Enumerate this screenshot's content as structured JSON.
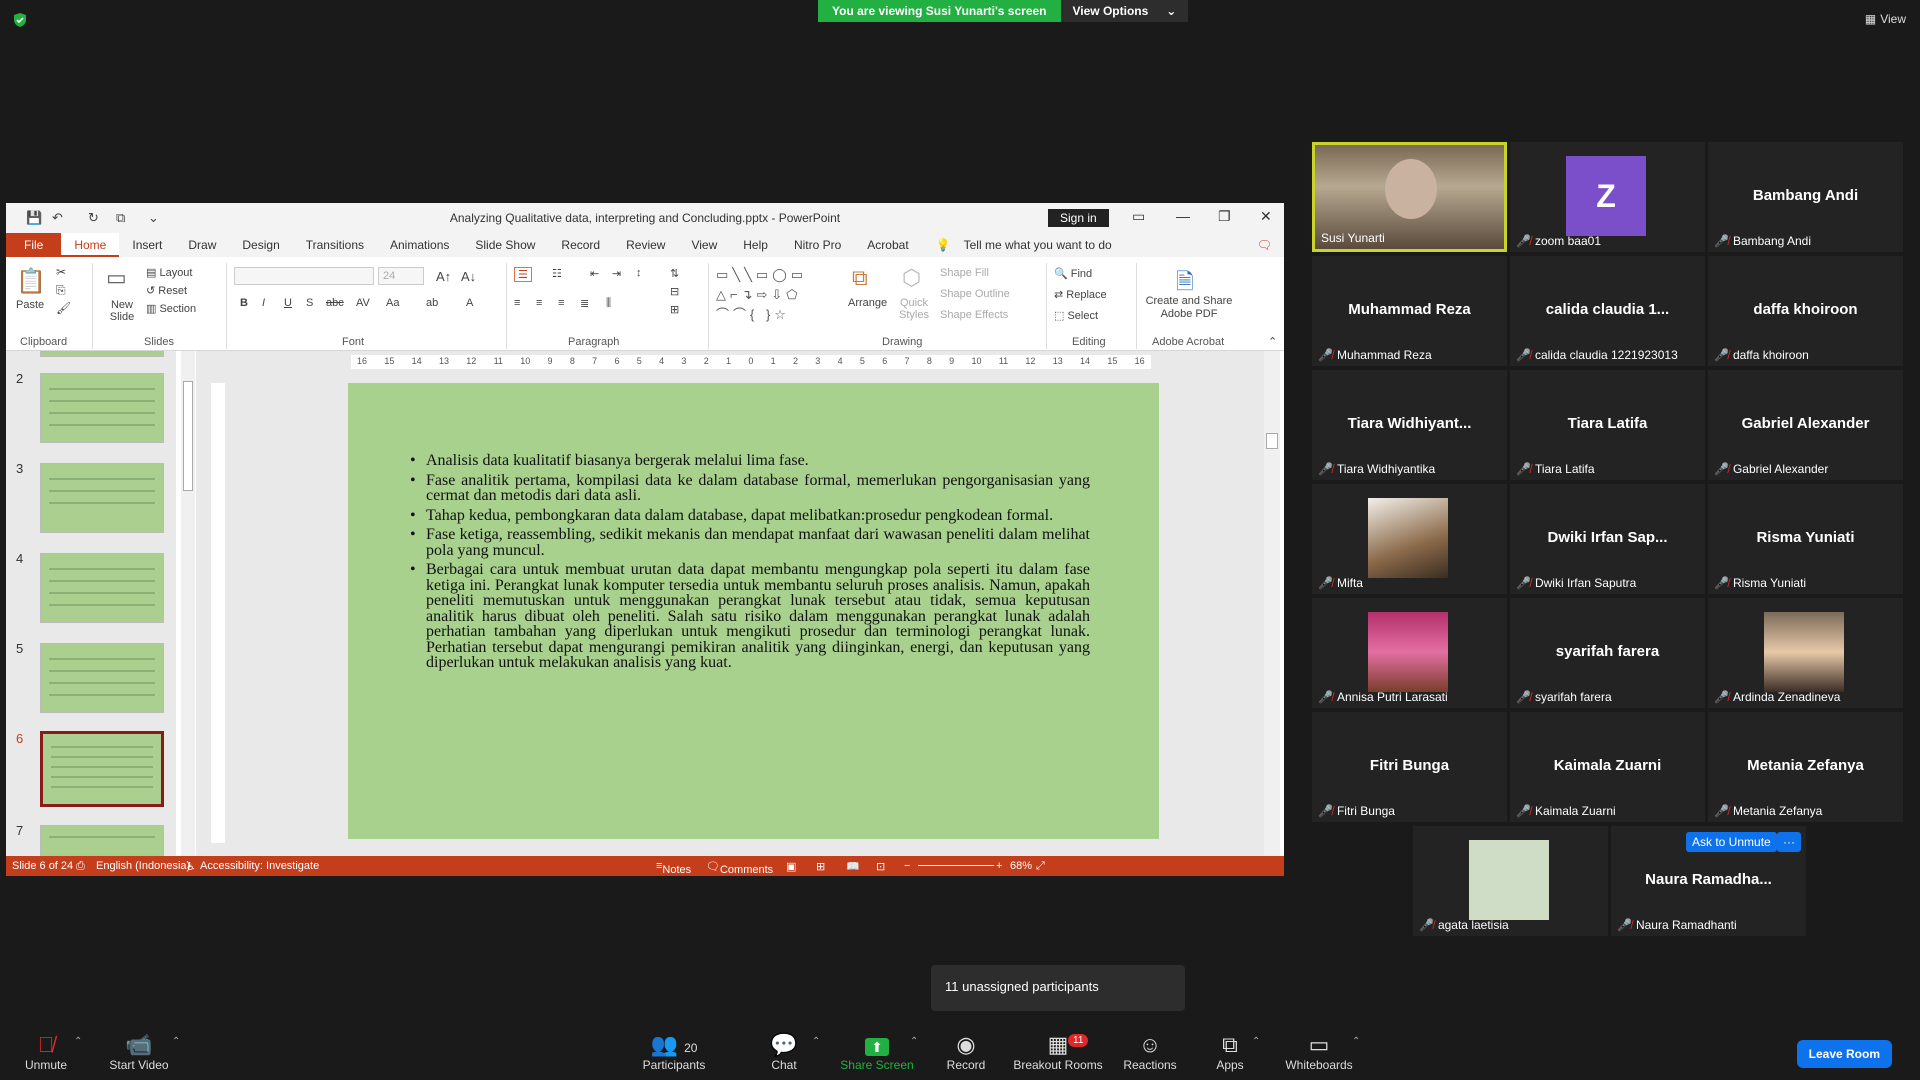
{
  "zoom": {
    "banner": "You are viewing Susi Yunarti's screen",
    "view_options": "View Options",
    "view_button": "View",
    "unassigned": "11 unassigned participants",
    "ask_to_unmute": "Ask to Unmute",
    "more": "···",
    "toolbar": {
      "unmute": "Unmute",
      "start_video": "Start Video",
      "participants": "Participants",
      "participants_count": "20",
      "chat": "Chat",
      "share_screen": "Share Screen",
      "record": "Record",
      "breakout_rooms": "Breakout Rooms",
      "breakout_badge": "11",
      "reactions": "Reactions",
      "apps": "Apps",
      "whiteboards": "Whiteboards",
      "leave_room": "Leave Room"
    },
    "tiles": [
      {
        "name": "Susi Yunarti",
        "label": "Susi Yunarti",
        "type": "video",
        "speaking": true
      },
      {
        "name": "Z",
        "label": "zoom baa01",
        "type": "letter"
      },
      {
        "name": "Bambang Andi",
        "label": "Bambang Andi",
        "type": "name"
      },
      {
        "name": "Muhammad Reza",
        "label": "Muhammad Reza",
        "type": "name"
      },
      {
        "name": "calida  claudia  1...",
        "label": "calida claudia 1221923013",
        "type": "name"
      },
      {
        "name": "daffa khoiroon",
        "label": "daffa khoiroon",
        "type": "name"
      },
      {
        "name": "Tiara  Widhiyant...",
        "label": "Tiara Widhiyantika",
        "type": "name"
      },
      {
        "name": "Tiara Latifa",
        "label": "Tiara Latifa",
        "type": "name"
      },
      {
        "name": "Gabriel Alexander",
        "label": "Gabriel Alexander",
        "type": "name"
      },
      {
        "name": "",
        "label": "Mifta",
        "type": "photo"
      },
      {
        "name": "Dwiki  Irfan  Sap...",
        "label": "Dwiki Irfan Saputra",
        "type": "name"
      },
      {
        "name": "Risma Yuniati",
        "label": "Risma Yuniati",
        "type": "name"
      },
      {
        "name": "",
        "label": "Annisa Putri Larasati",
        "type": "photo"
      },
      {
        "name": "syarifah farera",
        "label": "syarifah farera",
        "type": "name"
      },
      {
        "name": "",
        "label": "Ardinda Zenadineva",
        "type": "photo"
      },
      {
        "name": "Fitri Bunga",
        "label": "Fitri Bunga",
        "type": "name"
      },
      {
        "name": "Kaimala Zuarni",
        "label": "Kaimala Zuarni",
        "type": "name"
      },
      {
        "name": "Metania Zefanya",
        "label": "Metania Zefanya",
        "type": "name"
      },
      {
        "name": "",
        "label": "agata laetisia",
        "type": "photo"
      },
      {
        "name": "Naura  Ramadha...",
        "label": "Naura Ramadhanti",
        "type": "name"
      }
    ]
  },
  "ppt": {
    "title": "Analyzing Qualitative data,  interpreting and Concluding.pptx  -  PowerPoint",
    "sign_in": "Sign in",
    "tabs": [
      "File",
      "Home",
      "Insert",
      "Draw",
      "Design",
      "Transitions",
      "Animations",
      "Slide Show",
      "Record",
      "Review",
      "View",
      "Help",
      "Nitro Pro",
      "Acrobat"
    ],
    "tell_me": "Tell me what you want to do",
    "ribbon": {
      "paste": "Paste",
      "clipboard": "Clipboard",
      "new_slide": "New Slide",
      "layout": "Layout",
      "reset": "Reset",
      "section": "Section",
      "slides": "Slides",
      "font": "Font",
      "font_size": "24",
      "paragraph": "Paragraph",
      "arrange": "Arrange",
      "quick_styles": "Quick Styles",
      "shape_fill": "Shape Fill",
      "shape_outline": "Shape Outline",
      "shape_effects": "Shape Effects",
      "drawing": "Drawing",
      "find": "Find",
      "replace": "Replace",
      "select": "Select",
      "editing": "Editing",
      "create_pdf": "Create and Share Adobe PDF",
      "adobe_acrobat": "Adobe Acrobat"
    },
    "thumb_numbers": [
      "2",
      "3",
      "4",
      "5",
      "6",
      "7"
    ],
    "ruler_ticks": [
      "16",
      "15",
      "14",
      "13",
      "12",
      "11",
      "10",
      "9",
      "8",
      "7",
      "6",
      "5",
      "4",
      "3",
      "2",
      "1",
      "0",
      "1",
      "2",
      "3",
      "4",
      "5",
      "6",
      "7",
      "8",
      "9",
      "10",
      "11",
      "12",
      "13",
      "14",
      "15",
      "16"
    ],
    "slide_bullets": [
      "Analisis data kualitatif biasanya bergerak melalui lima fase.",
      "Fase analitik pertama, kompilasi data ke dalam database formal, memerlukan pengorganisasian yang cermat dan metodis dari data asli.",
      "Tahap kedua, pembongkaran data dalam database, dapat melibatkan:prosedur pengkodean formal.",
      "Fase ketiga, reassembling, sedikit mekanis dan mendapat manfaat dari wawasan peneliti dalam melihat pola yang muncul.",
      "Berbagai cara untuk membuat urutan data dapat membantu mengungkap pola seperti itu dalam fase ketiga ini. Perangkat lunak komputer tersedia untuk membantu seluruh proses analisis. Namun, apakah peneliti memutuskan untuk menggunakan perangkat lunak tersebut atau tidak, semua keputusan analitik harus dibuat oleh peneliti. Salah satu risiko dalam menggunakan perangkat lunak adalah perhatian tambahan yang diperlukan untuk mengikuti prosedur dan terminologi perangkat lunak. Perhatian tersebut dapat mengurangi pemikiran analitik yang diinginkan, energi, dan keputusan yang diperlukan untuk melakukan analisis yang kuat."
    ],
    "status": {
      "slide": "Slide 6 of 24",
      "language": "English (Indonesia)",
      "accessibility": "Accessibility: Investigate",
      "notes": "Notes",
      "comments": "Comments",
      "zoom": "68%"
    }
  },
  "colors": {
    "ppt_accent": "#c43e1c",
    "zoom_green": "#23b042",
    "zoom_blue": "#0e72ed",
    "slide_bg": "#a9d18e"
  }
}
